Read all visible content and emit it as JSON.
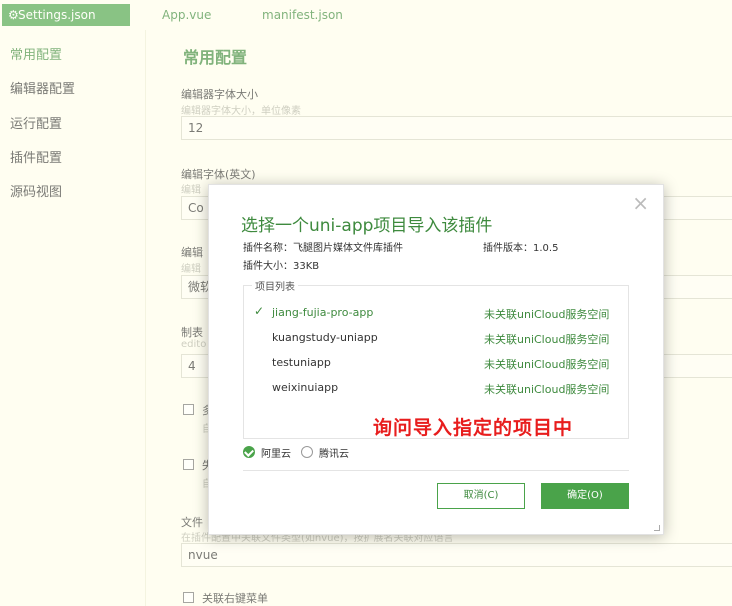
{
  "tabs": [
    {
      "label": "Settings.json",
      "icon": "gear-icon",
      "active": true
    },
    {
      "label": "App.vue",
      "active": false
    },
    {
      "label": "manifest.json",
      "active": false
    }
  ],
  "sidebar": {
    "items": [
      {
        "label": "常用配置",
        "active": true
      },
      {
        "label": "编辑器配置"
      },
      {
        "label": "运行配置"
      },
      {
        "label": "插件配置"
      },
      {
        "label": "源码视图"
      }
    ]
  },
  "main": {
    "title": "常用配置",
    "font_size": {
      "label": "编辑器字体大小",
      "hint": "编辑器字体大小，单位像素",
      "value": "12"
    },
    "font_en": {
      "label": "编辑字体(英文)",
      "hint": "编辑",
      "value": "Co"
    },
    "font_cn": {
      "label": "编辑",
      "hint": "编辑",
      "value": "微软"
    },
    "tab_size": {
      "label": "制表",
      "hint": "edito",
      "value": "4"
    },
    "checkbox1": {
      "label": "多",
      "hint": "自"
    },
    "checkbox2": {
      "label": "失",
      "hint": "自"
    },
    "file_assoc": {
      "label": "文件",
      "hint": "在插件配置中关联文件类型(如nvue)，按扩展名关联对应语言",
      "value": "nvue"
    },
    "context_menu": {
      "label": "关联右键菜单"
    }
  },
  "dialog": {
    "title": "选择一个uni-app项目导入该插件",
    "plugin_name": "插件名称：飞腿图片媒体文件库插件",
    "plugin_version": "插件版本：1.0.5",
    "plugin_size": "插件大小：33KB",
    "project_list_label": "项目列表",
    "projects": [
      {
        "name": "jiang-fujia-pro-app",
        "status": "未关联uniCloud服务空间",
        "selected": true
      },
      {
        "name": "kuangstudy-uniapp",
        "status": "未关联uniCloud服务空间",
        "selected": false
      },
      {
        "name": "testuniapp",
        "status": "未关联uniCloud服务空间",
        "selected": false
      },
      {
        "name": "weixinuiapp",
        "status": "未关联uniCloud服务空间",
        "selected": false
      }
    ],
    "annotation": "询问导入指定的项目中",
    "cloud_options": [
      {
        "label": "阿里云",
        "checked": true
      },
      {
        "label": "腾讯云",
        "checked": false
      }
    ],
    "cancel_label": "取消(C)",
    "ok_label": "确定(O)",
    "close_symbol": "×"
  },
  "colors": {
    "accent": "#4aa34a",
    "accent_text": "#3e8a3e",
    "annotation": "#e81d1d",
    "background": "#fffef2"
  }
}
